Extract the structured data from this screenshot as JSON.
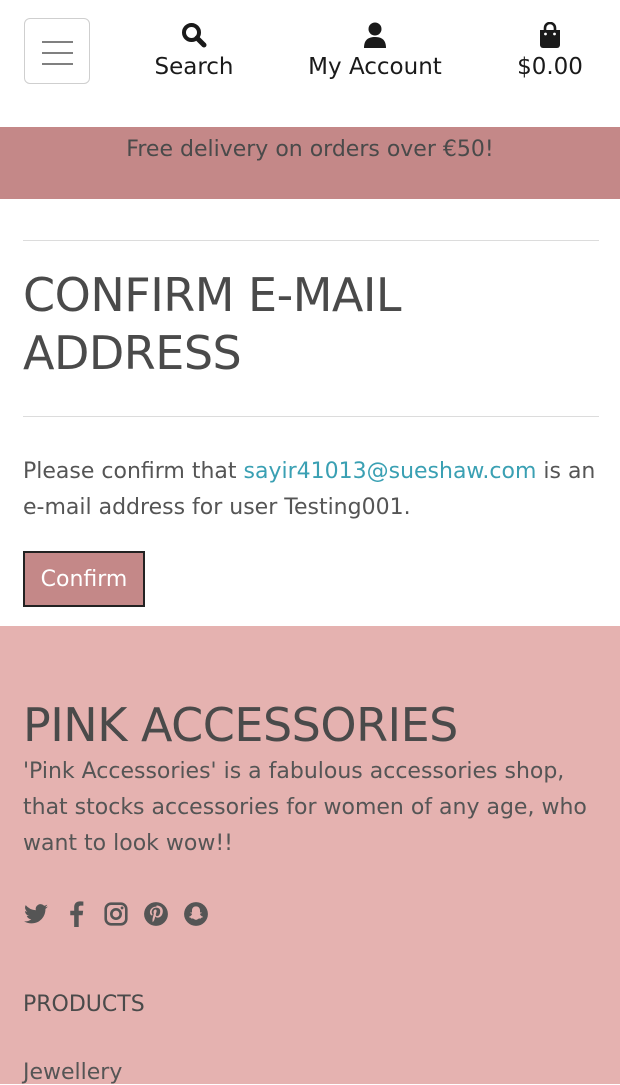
{
  "header": {
    "menu_icon": "hamburger-icon",
    "search": {
      "icon": "search-icon",
      "label": "Search"
    },
    "account": {
      "icon": "user-icon",
      "label": "My Account"
    },
    "bag": {
      "icon": "shopping-bag-icon",
      "total": "$0.00"
    }
  },
  "banner": {
    "text": "Free delivery on orders over €50!"
  },
  "main": {
    "title": "CONFIRM E-MAIL ADDRESS",
    "message": {
      "prefix": "Please confirm that ",
      "email": "sayir41013@sueshaw.com",
      "suffix": " is an e-mail address for user Testing001."
    },
    "confirm_label": "Confirm"
  },
  "footer": {
    "brand": "PINK ACCESSORIES",
    "about": "'Pink Accessories' is a fabulous accessories shop, that stocks accessories for women of any age, who want to look wow!!",
    "social_icons": [
      "twitter-icon",
      "facebook-icon",
      "instagram-icon",
      "pinterest-icon",
      "snapchat-icon"
    ],
    "products_heading": "PRODUCTS",
    "products": [
      "Jewellery"
    ]
  },
  "colors": {
    "banner": "#c48888",
    "footer": "#e5b2b0",
    "link": "#3aa0b3",
    "button": "#c48888"
  }
}
